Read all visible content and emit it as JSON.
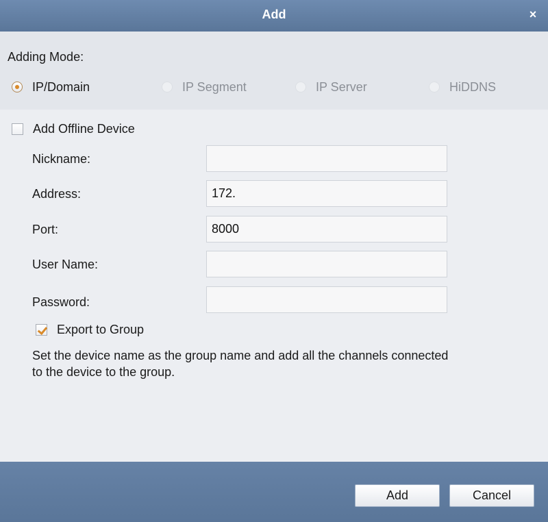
{
  "window": {
    "title": "Add",
    "close_glyph": "×"
  },
  "adding_mode": {
    "label": "Adding Mode:",
    "options": [
      {
        "label": "IP/Domain",
        "selected": true,
        "enabled": true
      },
      {
        "label": "IP Segment",
        "selected": false,
        "enabled": false
      },
      {
        "label": "IP Server",
        "selected": false,
        "enabled": false
      },
      {
        "label": "HiDDNS",
        "selected": false,
        "enabled": false
      }
    ]
  },
  "offline_device": {
    "label": "Add Offline Device",
    "checked": false
  },
  "fields": {
    "nickname": {
      "label": "Nickname:",
      "value": ""
    },
    "address": {
      "label": "Address:",
      "value": "172."
    },
    "port": {
      "label": "Port:",
      "value": "8000"
    },
    "username": {
      "label": "User Name:",
      "value": ""
    },
    "password": {
      "label": "Password:",
      "value": ""
    }
  },
  "export_group": {
    "label": "Export to Group",
    "checked": true
  },
  "note": "Set the device name as the group name and add all the channels connected to the device to the group.",
  "buttons": {
    "add": "Add",
    "cancel": "Cancel"
  },
  "colors": {
    "accent": "#d98a2a",
    "titlebar": "#5a7699"
  }
}
